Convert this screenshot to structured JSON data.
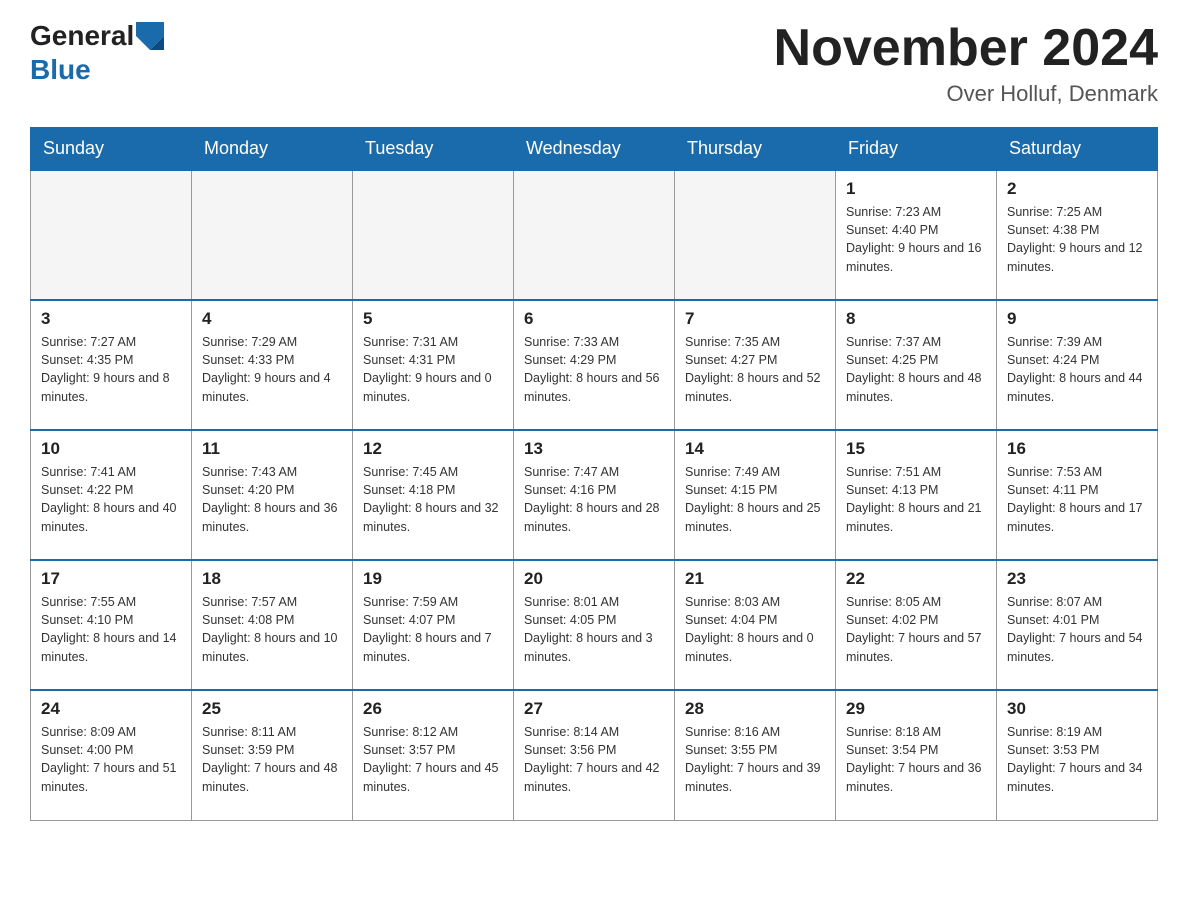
{
  "header": {
    "logo_general": "General",
    "logo_blue": "Blue",
    "title": "November 2024",
    "subtitle": "Over Holluf, Denmark"
  },
  "days_of_week": [
    "Sunday",
    "Monday",
    "Tuesday",
    "Wednesday",
    "Thursday",
    "Friday",
    "Saturday"
  ],
  "weeks": [
    [
      {
        "day": "",
        "info": ""
      },
      {
        "day": "",
        "info": ""
      },
      {
        "day": "",
        "info": ""
      },
      {
        "day": "",
        "info": ""
      },
      {
        "day": "",
        "info": ""
      },
      {
        "day": "1",
        "info": "Sunrise: 7:23 AM\nSunset: 4:40 PM\nDaylight: 9 hours\nand 16 minutes."
      },
      {
        "day": "2",
        "info": "Sunrise: 7:25 AM\nSunset: 4:38 PM\nDaylight: 9 hours\nand 12 minutes."
      }
    ],
    [
      {
        "day": "3",
        "info": "Sunrise: 7:27 AM\nSunset: 4:35 PM\nDaylight: 9 hours\nand 8 minutes."
      },
      {
        "day": "4",
        "info": "Sunrise: 7:29 AM\nSunset: 4:33 PM\nDaylight: 9 hours\nand 4 minutes."
      },
      {
        "day": "5",
        "info": "Sunrise: 7:31 AM\nSunset: 4:31 PM\nDaylight: 9 hours\nand 0 minutes."
      },
      {
        "day": "6",
        "info": "Sunrise: 7:33 AM\nSunset: 4:29 PM\nDaylight: 8 hours\nand 56 minutes."
      },
      {
        "day": "7",
        "info": "Sunrise: 7:35 AM\nSunset: 4:27 PM\nDaylight: 8 hours\nand 52 minutes."
      },
      {
        "day": "8",
        "info": "Sunrise: 7:37 AM\nSunset: 4:25 PM\nDaylight: 8 hours\nand 48 minutes."
      },
      {
        "day": "9",
        "info": "Sunrise: 7:39 AM\nSunset: 4:24 PM\nDaylight: 8 hours\nand 44 minutes."
      }
    ],
    [
      {
        "day": "10",
        "info": "Sunrise: 7:41 AM\nSunset: 4:22 PM\nDaylight: 8 hours\nand 40 minutes."
      },
      {
        "day": "11",
        "info": "Sunrise: 7:43 AM\nSunset: 4:20 PM\nDaylight: 8 hours\nand 36 minutes."
      },
      {
        "day": "12",
        "info": "Sunrise: 7:45 AM\nSunset: 4:18 PM\nDaylight: 8 hours\nand 32 minutes."
      },
      {
        "day": "13",
        "info": "Sunrise: 7:47 AM\nSunset: 4:16 PM\nDaylight: 8 hours\nand 28 minutes."
      },
      {
        "day": "14",
        "info": "Sunrise: 7:49 AM\nSunset: 4:15 PM\nDaylight: 8 hours\nand 25 minutes."
      },
      {
        "day": "15",
        "info": "Sunrise: 7:51 AM\nSunset: 4:13 PM\nDaylight: 8 hours\nand 21 minutes."
      },
      {
        "day": "16",
        "info": "Sunrise: 7:53 AM\nSunset: 4:11 PM\nDaylight: 8 hours\nand 17 minutes."
      }
    ],
    [
      {
        "day": "17",
        "info": "Sunrise: 7:55 AM\nSunset: 4:10 PM\nDaylight: 8 hours\nand 14 minutes."
      },
      {
        "day": "18",
        "info": "Sunrise: 7:57 AM\nSunset: 4:08 PM\nDaylight: 8 hours\nand 10 minutes."
      },
      {
        "day": "19",
        "info": "Sunrise: 7:59 AM\nSunset: 4:07 PM\nDaylight: 8 hours\nand 7 minutes."
      },
      {
        "day": "20",
        "info": "Sunrise: 8:01 AM\nSunset: 4:05 PM\nDaylight: 8 hours\nand 3 minutes."
      },
      {
        "day": "21",
        "info": "Sunrise: 8:03 AM\nSunset: 4:04 PM\nDaylight: 8 hours\nand 0 minutes."
      },
      {
        "day": "22",
        "info": "Sunrise: 8:05 AM\nSunset: 4:02 PM\nDaylight: 7 hours\nand 57 minutes."
      },
      {
        "day": "23",
        "info": "Sunrise: 8:07 AM\nSunset: 4:01 PM\nDaylight: 7 hours\nand 54 minutes."
      }
    ],
    [
      {
        "day": "24",
        "info": "Sunrise: 8:09 AM\nSunset: 4:00 PM\nDaylight: 7 hours\nand 51 minutes."
      },
      {
        "day": "25",
        "info": "Sunrise: 8:11 AM\nSunset: 3:59 PM\nDaylight: 7 hours\nand 48 minutes."
      },
      {
        "day": "26",
        "info": "Sunrise: 8:12 AM\nSunset: 3:57 PM\nDaylight: 7 hours\nand 45 minutes."
      },
      {
        "day": "27",
        "info": "Sunrise: 8:14 AM\nSunset: 3:56 PM\nDaylight: 7 hours\nand 42 minutes."
      },
      {
        "day": "28",
        "info": "Sunrise: 8:16 AM\nSunset: 3:55 PM\nDaylight: 7 hours\nand 39 minutes."
      },
      {
        "day": "29",
        "info": "Sunrise: 8:18 AM\nSunset: 3:54 PM\nDaylight: 7 hours\nand 36 minutes."
      },
      {
        "day": "30",
        "info": "Sunrise: 8:19 AM\nSunset: 3:53 PM\nDaylight: 7 hours\nand 34 minutes."
      }
    ]
  ]
}
